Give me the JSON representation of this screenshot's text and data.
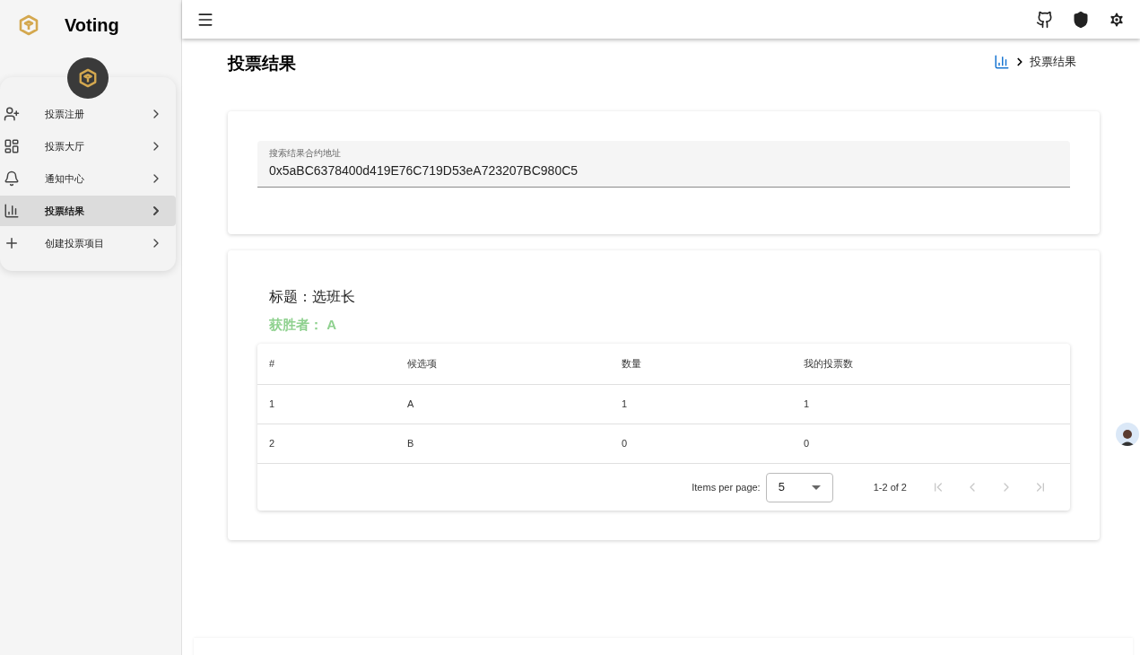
{
  "brand": {
    "title": "Voting"
  },
  "sidebar": {
    "items": [
      {
        "label": "投票注册",
        "selected": false
      },
      {
        "label": "投票大厅",
        "selected": false
      },
      {
        "label": "通知中心",
        "selected": false
      },
      {
        "label": "投票结果",
        "selected": true
      },
      {
        "label": "创建投票项目",
        "selected": false
      }
    ]
  },
  "page": {
    "title": "投票结果",
    "breadcrumb": "投票结果"
  },
  "search": {
    "label": "搜索结果合约地址",
    "value": "0x5aBC6378400d419E76C719D53eA723207BC980C5"
  },
  "result": {
    "title": "标题：选班长",
    "winner": "获胜者： A",
    "table": {
      "columns": [
        "#",
        "候选项",
        "数量",
        "我的投票数"
      ],
      "rows": [
        [
          "1",
          "A",
          "1",
          "1"
        ],
        [
          "2",
          "B",
          "0",
          "0"
        ]
      ]
    },
    "pagination": {
      "items_label": "Items per page:",
      "page_size": "5",
      "range": "1-2 of 2",
      "buttons": [
        {
          "kind": "first",
          "disabled": true
        },
        {
          "kind": "prev",
          "disabled": true
        },
        {
          "kind": "next",
          "disabled": true
        },
        {
          "kind": "last",
          "disabled": true
        }
      ]
    }
  }
}
